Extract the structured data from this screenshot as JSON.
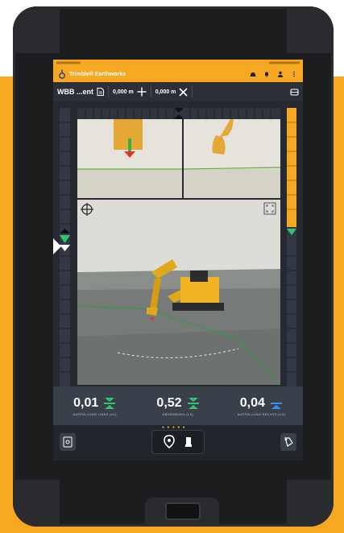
{
  "app": {
    "title": "Trimble® Earthworks"
  },
  "toolbar": {
    "design_name": "WBB ...ent",
    "offset_1": "0,000 m",
    "offset_2": "0,000 m"
  },
  "readouts": [
    {
      "value": "0,01",
      "label": "AUFFÜLLUNG LINKS (LK)",
      "arrow_color": "#38c172"
    },
    {
      "value": "0,52",
      "label": "ABGRABUNG (LK)",
      "arrow_color": "#38c172"
    },
    {
      "value": "0,04",
      "label": "AUFFÜLLUNG RECHTS (LK)",
      "arrow_color": "#3b8ee6"
    }
  ],
  "colors": {
    "accent": "#f7a823",
    "on_grade": "#38c172",
    "cut_fill_arrow": "#d93a2b"
  },
  "icons": {
    "logo": "trimble-logo-icon",
    "app_actions": [
      "hardhat-icon",
      "bell-icon",
      "person-icon",
      "more-vert-icon"
    ],
    "toolbar": [
      "document-icon",
      "move-icon",
      "close-icon",
      "layers-icon"
    ],
    "nav": [
      "settings-box-icon",
      "location-pin-icon",
      "machine-icon",
      "bucket-icon"
    ]
  }
}
